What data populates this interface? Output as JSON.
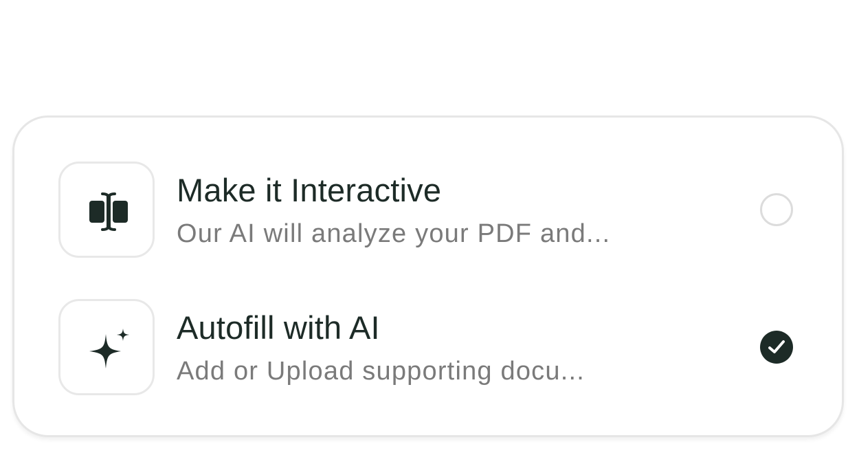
{
  "options": [
    {
      "title": "Make it Interactive",
      "description": "Our AI will analyze your PDF and...",
      "icon": "text-cursor-input-icon",
      "selected": false
    },
    {
      "title": "Autofill with AI",
      "description": "Add or Upload supporting docu...",
      "icon": "sparkles-icon",
      "selected": true
    }
  ],
  "colors": {
    "primary": "#1d2b27",
    "muted_text": "#7a7a7a",
    "border": "#e6e6e6"
  }
}
